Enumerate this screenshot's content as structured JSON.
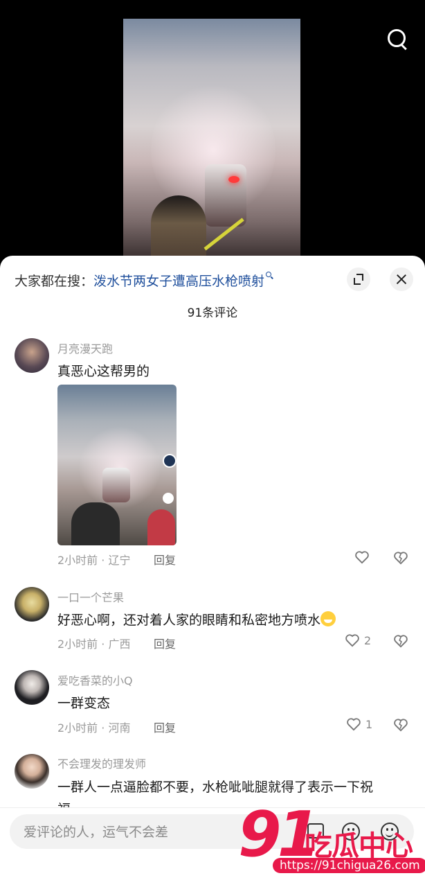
{
  "video": {
    "search_icon": "search-icon"
  },
  "panel": {
    "search_prefix": "大家都在搜：",
    "search_query": "泼水节两女子遭高压水枪喷射",
    "comment_count": "91条评论"
  },
  "comments": [
    {
      "nickname": "月亮漫天跑",
      "text": "真恶心这帮男的",
      "time_location": "2小时前 · 辽宁",
      "reply_label": "回复",
      "likes": "",
      "has_image": true
    },
    {
      "nickname": "一口一个芒果",
      "text": "好恶心啊，还对着人家的眼睛和私密地方喷水",
      "time_location": "2小时前 · 广西",
      "reply_label": "回复",
      "likes": "2"
    },
    {
      "nickname": "爱吃香菜的小Q",
      "text": "一群变态",
      "time_location": "2小时前 · 河南",
      "reply_label": "回复",
      "likes": "1"
    },
    {
      "nickname": "不会理发的理发师",
      "text": "一群人一点逼脸都不要，水枪呲呲腿就得了表示一下祝",
      "text_line2": "福"
    }
  ],
  "input": {
    "placeholder": "爱评论的人，运气不会差"
  },
  "watermark": {
    "number": "91",
    "name": "吃瓜中心",
    "url": "https://91chigua26.com"
  },
  "colors": {
    "link": "#1f4f9c",
    "watermark": "#e8194a"
  }
}
